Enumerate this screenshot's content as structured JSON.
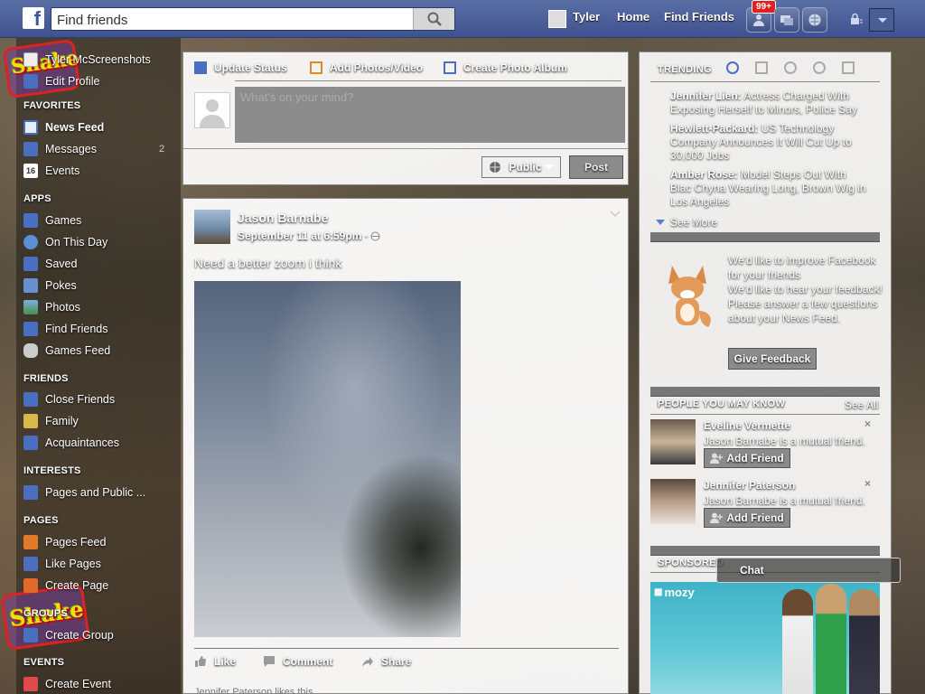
{
  "topbar": {
    "logo": "f",
    "search_placeholder": "Find friends",
    "user_name": "Tyler",
    "nav_home": "Home",
    "nav_find_friends": "Find Friends",
    "notif_badge": "99+"
  },
  "sidebar": {
    "profile_name": "Tyler McScreenshots",
    "edit_profile": "Edit Profile",
    "favorites_head": "FAVORITES",
    "news_feed": "News Feed",
    "messages": "Messages",
    "messages_count": "2",
    "events": "Events",
    "events_icon_day": "16",
    "apps_head": "APPS",
    "games": "Games",
    "on_this_day": "On This Day",
    "saved": "Saved",
    "pokes": "Pokes",
    "photos": "Photos",
    "find_friends": "Find Friends",
    "games_feed": "Games Feed",
    "friends_head": "FRIENDS",
    "close_friends": "Close Friends",
    "family": "Family",
    "acquaintances": "Acquaintances",
    "interests_head": "INTERESTS",
    "pages_public": "Pages and Public ...",
    "pages_head": "PAGES",
    "pages_feed": "Pages Feed",
    "like_pages": "Like Pages",
    "create_page": "Create Page",
    "groups_head": "GROUPS",
    "create_group": "Create Group",
    "events_head": "EVENTS",
    "create_event": "Create Event"
  },
  "composer": {
    "update_status": "Update Status",
    "add_photos": "Add Photos/Video",
    "create_album": "Create Photo Album",
    "placeholder": "What's on your mind?",
    "privacy": "Public",
    "post_button": "Post"
  },
  "post": {
    "author": "Jason Barnabe",
    "timestamp": "September 11 at 6:59pm · ",
    "text": "Need a better zoom i think",
    "like": "Like",
    "comment": "Comment",
    "share": "Share",
    "likes_line": "Jennifer Paterson likes this."
  },
  "rightcol": {
    "trending_head": "TRENDING",
    "trends": [
      {
        "name": "Jennifer Lien:",
        "text": " Actress Charged With Exposing Herself to Minors, Police Say"
      },
      {
        "name": "Hewlett-Packard:",
        "text": " US Technology Company Announces It Will Cut Up to 30,000 Jobs"
      },
      {
        "name": "Amber Rose:",
        "text": " Model Steps Out With Blac Chyna Wearing Long, Brown Wig in Los Angeles"
      }
    ],
    "see_more": "See More",
    "feedback_title": "We'd like to improve Facebook for your friends",
    "feedback_body": "We'd like to hear your feedback! Please answer a few questions about your News Feed.",
    "feedback_button": "Give Feedback",
    "pymk_head": "PEOPLE YOU MAY KNOW",
    "see_all": "See All",
    "people": [
      {
        "name": "Eveline Vermette",
        "mutual": "Jason Barnabe is a mutual friend.",
        "button": "Add Friend"
      },
      {
        "name": "Jennifer Paterson",
        "mutual": "Jason Barnabe is a mutual friend.",
        "button": "Add Friend"
      }
    ],
    "sponsored_head": "SPONSORED",
    "ad_brand": "mozy"
  },
  "chat": {
    "label": "Chat"
  }
}
